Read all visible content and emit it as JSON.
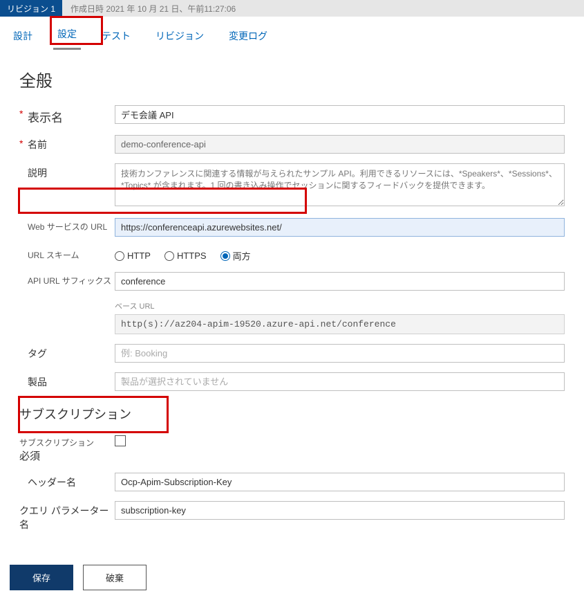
{
  "revision": {
    "badge": "リビジョン 1",
    "created": "作成日時 2021 年 10 月 21 日、午前11:27:06"
  },
  "tabs": {
    "design": "設計",
    "settings": "設定",
    "test": "テスト",
    "revisions": "リビジョン",
    "changelog": "変更ログ"
  },
  "general": {
    "heading": "全般",
    "display_name_label": "表示名",
    "display_name": "デモ会議 API",
    "name_label": "名前",
    "name": "demo-conference-api",
    "description_label": "説明",
    "description": "技術カンファレンスに関連する情報が与えられたサンプル API。利用できるリソースには、*Speakers*、*Sessions*、*Topics* が含まれます。1 回の書き込み操作でセッションに関するフィードバックを提供できます。",
    "web_service_url_label": "Web サービスの URL",
    "web_service_url": "https://conferenceapi.azurewebsites.net/",
    "url_scheme_label": "URL スキーム",
    "scheme_http": "HTTP",
    "scheme_https": "HTTPS",
    "scheme_both": "両方",
    "api_suffix_label": "API URL サフィックス",
    "api_suffix": "conference",
    "base_url_label": "ベース URL",
    "base_url": "http(s)://az204-apim-19520.azure-api.net/conference",
    "tags_label": "タグ",
    "tags_placeholder": "例: Booking",
    "products_label": "製品",
    "products_placeholder": "製品が選択されていません"
  },
  "subscription": {
    "heading": "サブスクリプション",
    "required_label1": "サブスクリプション",
    "required_label2": "必須",
    "header_name_label": "ヘッダー名",
    "header_name": "Ocp-Apim-Subscription-Key",
    "query_param_label1": "クエリ パラメーター",
    "query_param_label2": "名",
    "query_param": "subscription-key"
  },
  "footer": {
    "save": "保存",
    "discard": "破棄"
  }
}
